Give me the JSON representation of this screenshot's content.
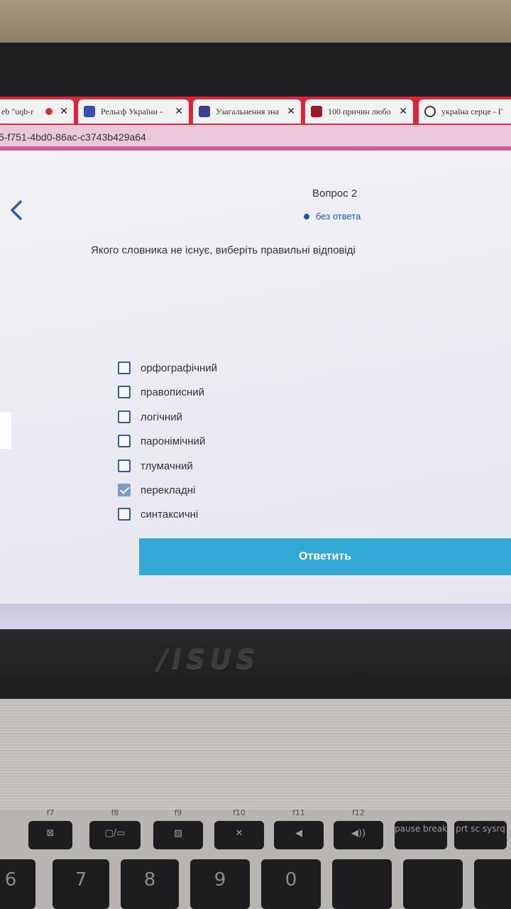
{
  "browser": {
    "tabs": [
      {
        "title": "eb \"uqb-r",
        "icon_color": "#c63a2d"
      },
      {
        "title": "Рельєф України -",
        "icon_color": "#3a4fb0"
      },
      {
        "title": "Узагальнення зна",
        "icon_color": "#3b3f8f"
      },
      {
        "title": "100 причин любо",
        "icon_color": "#9b1a2a"
      },
      {
        "title": "україна серце - Г",
        "icon_color": "#333333"
      }
    ],
    "close_glyph": "✕",
    "url": "5-f751-4bd0-86ac-c3743b429a64"
  },
  "quiz": {
    "question_number": "Вопрос 2",
    "status": "без ответа",
    "question_text": "Якого словника не існує, виберіть правильні відповіді",
    "options": [
      {
        "label": "орфографічний",
        "checked": false
      },
      {
        "label": "правописний",
        "checked": false
      },
      {
        "label": "логічний",
        "checked": false
      },
      {
        "label": "паронімічний",
        "checked": false
      },
      {
        "label": "тлумачний",
        "checked": false
      },
      {
        "label": "перекладні",
        "checked": true
      },
      {
        "label": "синтаксичні",
        "checked": false
      }
    ],
    "submit_label": "Ответить"
  },
  "laptop": {
    "brand": "/ISUS",
    "keys": [
      {
        "fn": "f7",
        "sym": "⊠"
      },
      {
        "fn": "f8",
        "sym": "▢/▭"
      },
      {
        "fn": "f9",
        "sym": "▨"
      },
      {
        "fn": "f10",
        "sym": "✕"
      },
      {
        "fn": "f11",
        "sym": "◀"
      },
      {
        "fn": "f12",
        "sym": "◀))"
      },
      {
        "fn": "",
        "sym": "pause break"
      },
      {
        "fn": "",
        "sym": "prt sc sysrq"
      }
    ],
    "number_keys": [
      "6",
      "7",
      "8",
      "9",
      "0"
    ]
  }
}
